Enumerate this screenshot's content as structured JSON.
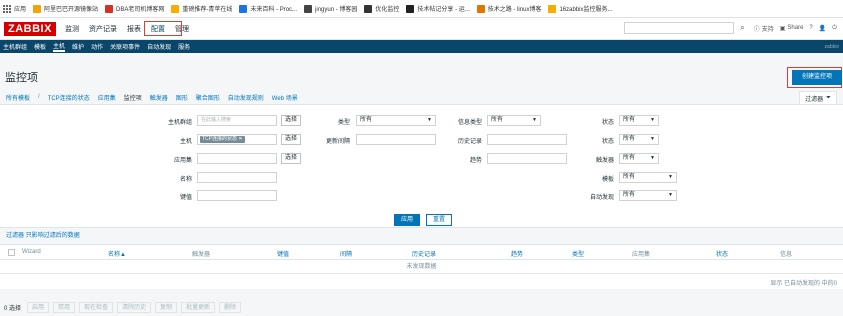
{
  "browser": {
    "bookmarks": [
      {
        "label": "应用",
        "color": "#5f6368"
      },
      {
        "label": "阿里巴巴开源镜像站",
        "color": "#f4a300"
      },
      {
        "label": "DBA老司机博客网",
        "color": "#d93025"
      },
      {
        "label": "重磅推荐-青苹在线",
        "color": "#f9ab00"
      },
      {
        "label": "未来百科 - Proc...",
        "color": "#1a73e8"
      },
      {
        "label": "jingyun - 博客园",
        "color": "#444444"
      },
      {
        "label": "优化监控",
        "color": "#333333"
      },
      {
        "label": "技术帖记分享 - 运...",
        "color": "#202124"
      },
      {
        "label": "技术之路 - linux博客",
        "color": "#e37400"
      },
      {
        "label": "16zabbix监控服务...",
        "color": "#f9ab00"
      }
    ]
  },
  "app": {
    "logo": "ZABBIX",
    "topnav": [
      "监测",
      "资产记录",
      "报表",
      "配置",
      "管理"
    ],
    "topnav_active": "配置",
    "search_icon": "search-icon",
    "support_label": "支持",
    "share_label": "Share",
    "help_label": "?",
    "user_icon": "user-icon",
    "power_icon": "power-icon",
    "subnav": [
      "主机群组",
      "模板",
      "主机",
      "维护",
      "动作",
      "关联项事件",
      "自动发现",
      "服务"
    ],
    "subnav_active": "主机",
    "username": "zabbix"
  },
  "page": {
    "title": "监控项",
    "create_button": "创建监控项"
  },
  "crumbs": {
    "all_templates": "所有模板",
    "template": "TCP连接的状态",
    "tabs": [
      "应用集",
      "监控项",
      "触发器",
      "图形",
      "聚合图形",
      "自动发现规则",
      "Web 场景"
    ],
    "active": "监控项",
    "filter_tab": "过滤器"
  },
  "filter": {
    "host_group_label": "主机群组",
    "host_group_placeholder": "在此输入搜索",
    "select_label": "选择",
    "host_label": "主机",
    "host_chip": "TCP连接的状态",
    "app_label": "应用集",
    "name_label": "名称",
    "key_label": "键值",
    "type_label": "类型",
    "type_value": "所有",
    "update_label": "更新间隔",
    "info_type_label": "信息类型",
    "info_type_value": "所有",
    "history_label": "历史记录",
    "trends_label": "趋势",
    "status_label": "状态",
    "status_value": "所有",
    "state_label": "状态",
    "state_value": "所有",
    "triggers_label": "触发器",
    "triggers_value": "所有",
    "template_label": "模板",
    "template_value": "所有",
    "discovery_label": "自动发现",
    "discovery_value": "所有",
    "apply": "应用",
    "reset": "重置"
  },
  "filter_note": {
    "prefix": "过滤器",
    "text": "只影响过滤后的数据"
  },
  "table": {
    "columns": [
      "Wizard",
      "名称▲",
      "触发器",
      "键值",
      "间隔",
      "历史记录",
      "趋势",
      "类型",
      "应用集",
      "状态",
      "信息"
    ],
    "no_data": "未发现数据",
    "footer": "显示 已自动发现的 中的0"
  },
  "actions": {
    "count": "0 选择",
    "buttons": [
      "启用",
      "禁用",
      "现在检查",
      "清除历史",
      "复制",
      "批量更新",
      "删除"
    ]
  }
}
